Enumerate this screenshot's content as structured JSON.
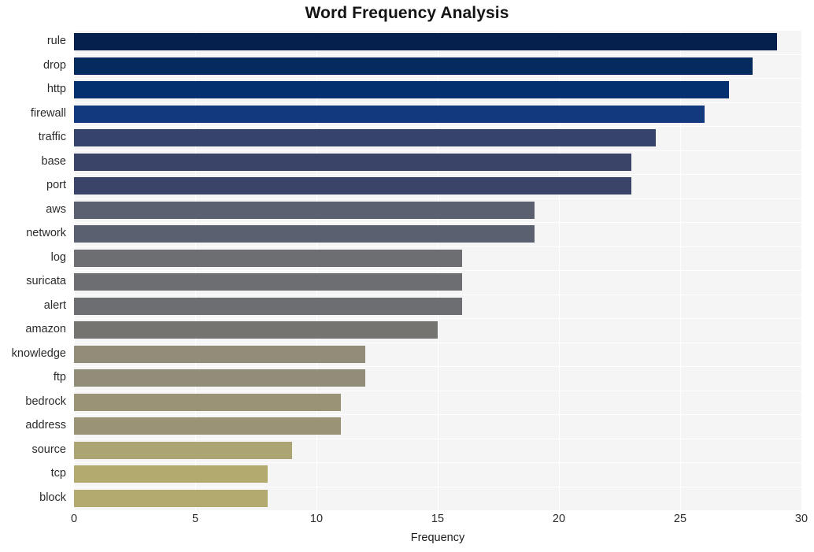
{
  "chart_data": {
    "type": "bar",
    "orientation": "horizontal",
    "title": "Word Frequency Analysis",
    "xlabel": "Frequency",
    "ylabel": "",
    "xlim": [
      0,
      30
    ],
    "xticks": [
      0,
      5,
      10,
      15,
      20,
      25,
      30
    ],
    "grid": true,
    "legend": null,
    "categories": [
      "rule",
      "drop",
      "http",
      "firewall",
      "traffic",
      "base",
      "port",
      "aws",
      "network",
      "log",
      "suricata",
      "alert",
      "amazon",
      "knowledge",
      "ftp",
      "bedrock",
      "address",
      "source",
      "tcp",
      "block"
    ],
    "values": [
      29,
      28,
      27,
      26,
      24,
      23,
      23,
      19,
      19,
      16,
      16,
      16,
      15,
      12,
      12,
      11,
      11,
      9,
      8,
      8
    ],
    "bar_colors": [
      "#06204e",
      "#042a5e",
      "#05306f",
      "#12397d",
      "#36436b",
      "#3a4469",
      "#3a4469",
      "#5a606f",
      "#5a606f",
      "#6d6e71",
      "#6d6e71",
      "#6d6e71",
      "#757471",
      "#918d78",
      "#918d78",
      "#9a9375",
      "#9a9375",
      "#aca472",
      "#b3aa70",
      "#b3aa70"
    ],
    "plot_background": "#f5f5f6",
    "gridline_color": "#ffffff",
    "figure_background": "#ffffff",
    "text_color": "#2b2b2b"
  }
}
